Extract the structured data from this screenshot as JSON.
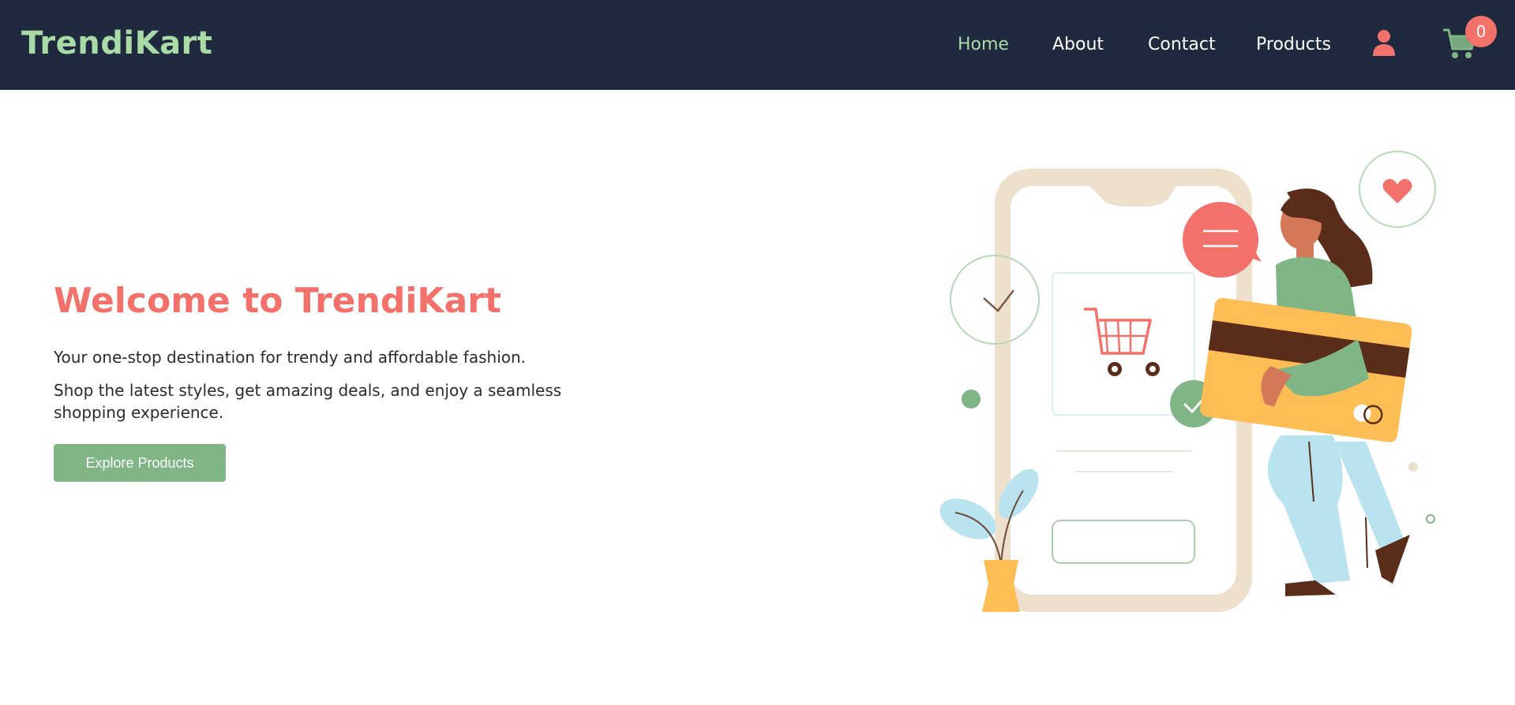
{
  "header": {
    "brand": "TrendiKart",
    "nav": [
      {
        "label": "Home",
        "active": true
      },
      {
        "label": "About",
        "active": false
      },
      {
        "label": "Contact",
        "active": false
      },
      {
        "label": "Products",
        "active": false
      }
    ],
    "user_icon": "user-icon",
    "cart_icon": "shopping-cart-icon",
    "cart_count": "0"
  },
  "hero": {
    "title": "Welcome to TrendiKart",
    "line1": "Your one-stop destination for trendy and affordable fashion.",
    "line2": "Shop the latest styles, get amazing deals, and enjoy a seamless shopping experience.",
    "cta_label": "Explore Products"
  },
  "colors": {
    "navbar_bg": "#1f2a3e",
    "brand_green": "#a9dba7",
    "accent_coral": "#f2716a",
    "button_green": "#80b585"
  }
}
